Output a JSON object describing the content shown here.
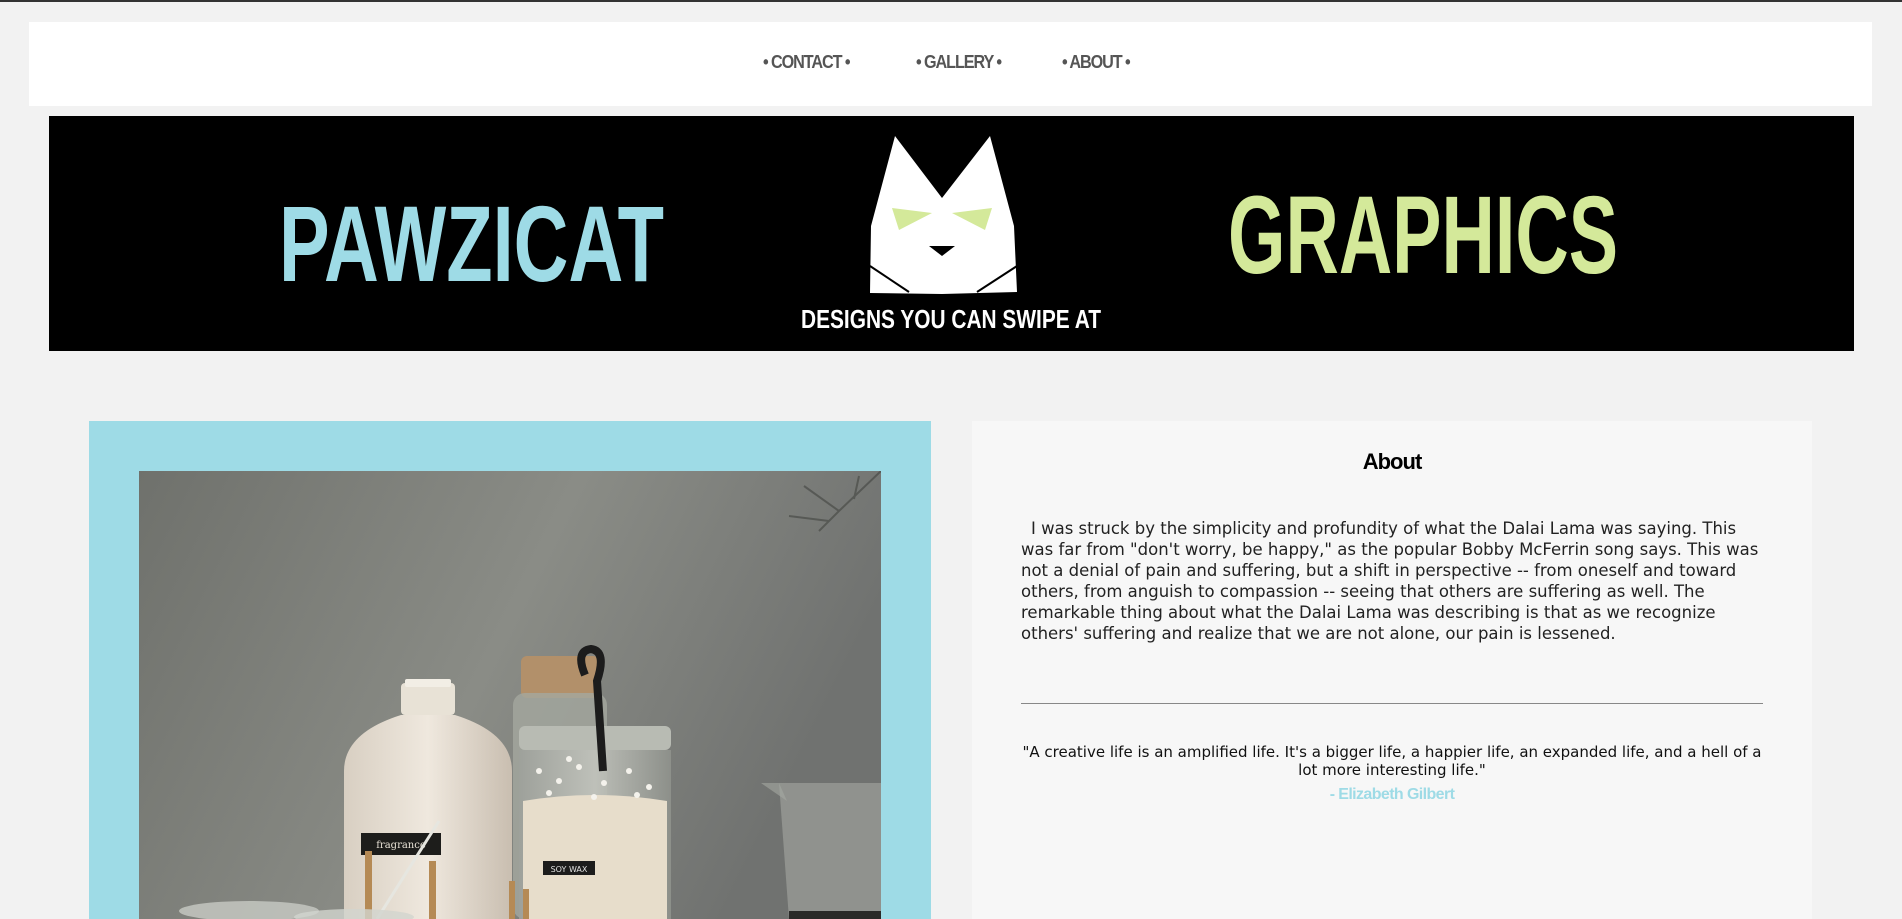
{
  "nav": {
    "contact": "• CONTACT •",
    "gallery": "• GALLERY •",
    "about": "• ABOUT •"
  },
  "banner": {
    "left_word": "PAWZICAT",
    "right_word": "GRAPHICS",
    "tagline": "DESIGNS YOU CAN SWIPE AT",
    "left_color": "#9edbe6",
    "right_color": "#d4e99a",
    "background": "#000000",
    "logo_icon": "cat-head-icon"
  },
  "about": {
    "title": "About",
    "body": "I was struck by the simplicity and profundity of what the Dalai Lama was saying. This was far from \"don't worry, be happy,\" as the popular Bobby McFerrin song says. This was not a denial of pain and suffering, but a shift in perspective -- from oneself and toward others, from anguish to compassion -- seeing that others are suffering as well. The remarkable thing about what the Dalai Lama was describing is that as we recognize others' suffering and realize that we are not alone, our pain is lessened.",
    "quote": "\"A creative life is an amplified life. It's a bigger life, a happier life, an expanded life, and a hell of a lot more interesting life.\"",
    "quote_author": "- Elizabeth Gilbert"
  },
  "colors": {
    "accent_blue": "#9edbe6",
    "accent_green": "#d4e99a",
    "page_bg": "#f2f2f2"
  },
  "photo": {
    "bottle_label": "fragrance",
    "jar_label": "SOY WAX"
  }
}
